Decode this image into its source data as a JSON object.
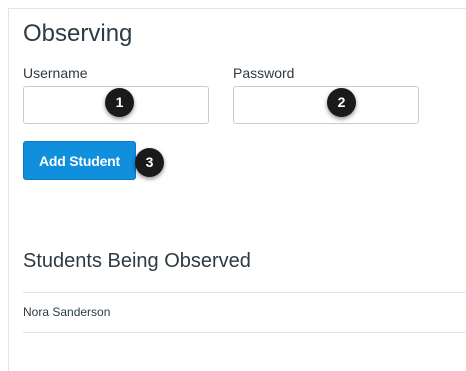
{
  "observing": {
    "title": "Observing",
    "username_label": "Username",
    "password_label": "Password",
    "username_value": "",
    "password_value": "",
    "add_button_label": "Add Student"
  },
  "callouts": {
    "one": "1",
    "two": "2",
    "three": "3"
  },
  "students_section": {
    "title": "Students Being Observed",
    "students": [
      {
        "name": "Nora Sanderson"
      }
    ]
  },
  "colors": {
    "primary_button": "#0f8fdc",
    "text": "#2d3b45",
    "callout_badge": "#1a1a1a",
    "border": "#c7cdd1"
  }
}
